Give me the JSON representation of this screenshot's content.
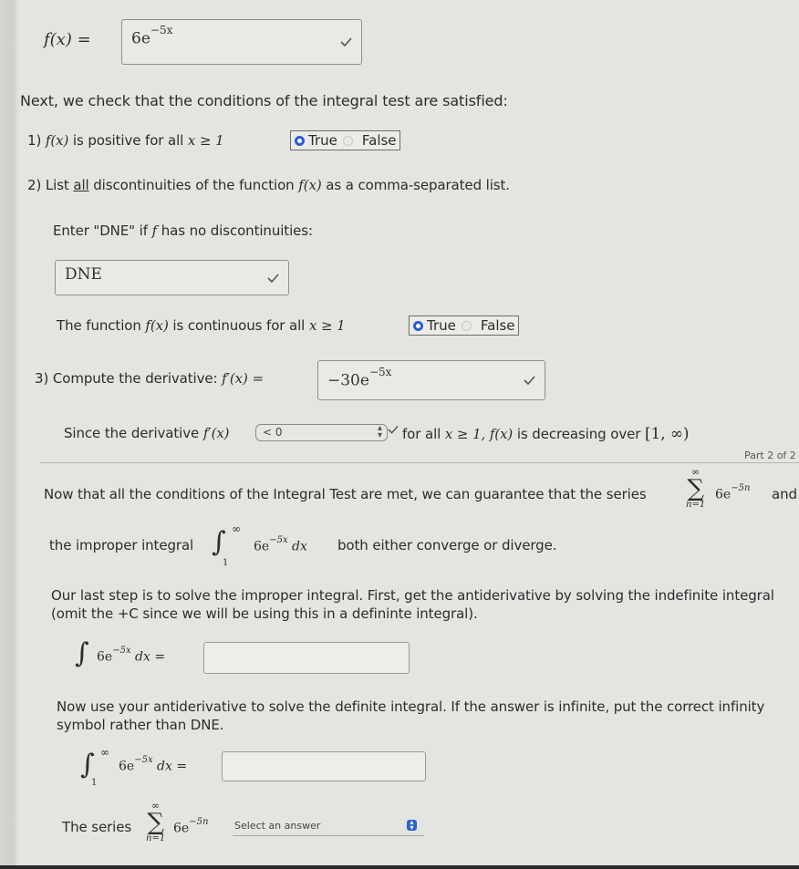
{
  "function_row": {
    "label": "f(x) =",
    "answer_base": "6e",
    "answer_exp": "−5x",
    "status": "correct"
  },
  "intro": "Next, we check that the conditions of the integral test are satisfied:",
  "q1": {
    "prefix": "1)",
    "math": "f(x)",
    "text": "is positive for all",
    "cond": "x ≥ 1",
    "options": [
      "True",
      "False"
    ],
    "selected": "True"
  },
  "q2": {
    "prefix": "2) List",
    "emph": "all",
    "text_a": "discontinuities of the function",
    "math": "f(x)",
    "text_b": "as a comma-separated list.",
    "instruction_a": "Enter \"DNE\" if",
    "instruction_math": "f",
    "instruction_b": "has no discontinuities:",
    "answer": "DNE",
    "status": "correct"
  },
  "q2_continuity": {
    "text_a": "The function",
    "math": "f(x)",
    "text_b": "is continuous for all",
    "cond": "x ≥ 1",
    "options": [
      "True",
      "False"
    ],
    "selected": "True"
  },
  "q3": {
    "label": "3) Compute the derivative:",
    "math": "f′(x) =",
    "answer_base": "−30e",
    "answer_exp": "−5x",
    "status": "correct"
  },
  "decreasing": {
    "text_a": "Since the derivative",
    "math": "f′(x)",
    "select_value": "< 0",
    "text_b": "for all",
    "cond": "x ≥ 1,",
    "math2": "f(x)",
    "text_c": "is decreasing over",
    "interval": "[1, ∞)"
  },
  "part_label": "Part 2 of 2",
  "part2": {
    "conditions_text": "Now that all the conditions of the Integral Test are met, we can guarantee that the series",
    "series_upper": "∞",
    "series_lower": "n=1",
    "series_base": "6e",
    "series_exp": "−5n",
    "and": "and",
    "improper_text": "the improper integral",
    "int_upper": "∞",
    "int_lower": "1",
    "int_base": "6e",
    "int_exp": "−5x",
    "int_dx": "dx",
    "both_text": "both either converge or diverge.",
    "last_step_line1": "Our last step is to solve the improper integral. First, get the antiderivative by solving the indefinite integral",
    "last_step_line2": "(omit the +C since we will be using this in a defininte integral).",
    "indef_base": "6e",
    "indef_exp": "−5x",
    "indef_dx": "dx =",
    "indef_answer": "",
    "definite_line1": "Now use your antiderivative to solve the definite integral. If the answer is infinite, put the correct infinity",
    "definite_line2": "symbol rather than DNE.",
    "def_upper": "∞",
    "def_lower": "1",
    "def_base": "6e",
    "def_exp": "−5x",
    "def_dx": "dx =",
    "def_answer": "",
    "series_label": "The series",
    "final_upper": "∞",
    "final_lower": "n=1",
    "final_base": "6e",
    "final_exp": "−5n",
    "select_placeholder": "Select an answer"
  },
  "icons": {
    "check": "checkmark-icon",
    "select_arrows": "updown-chevron-icon"
  },
  "colors": {
    "radio_selected": "#2b5ed0",
    "select_button": "#2b63c9",
    "background": "#e4e4e1"
  }
}
